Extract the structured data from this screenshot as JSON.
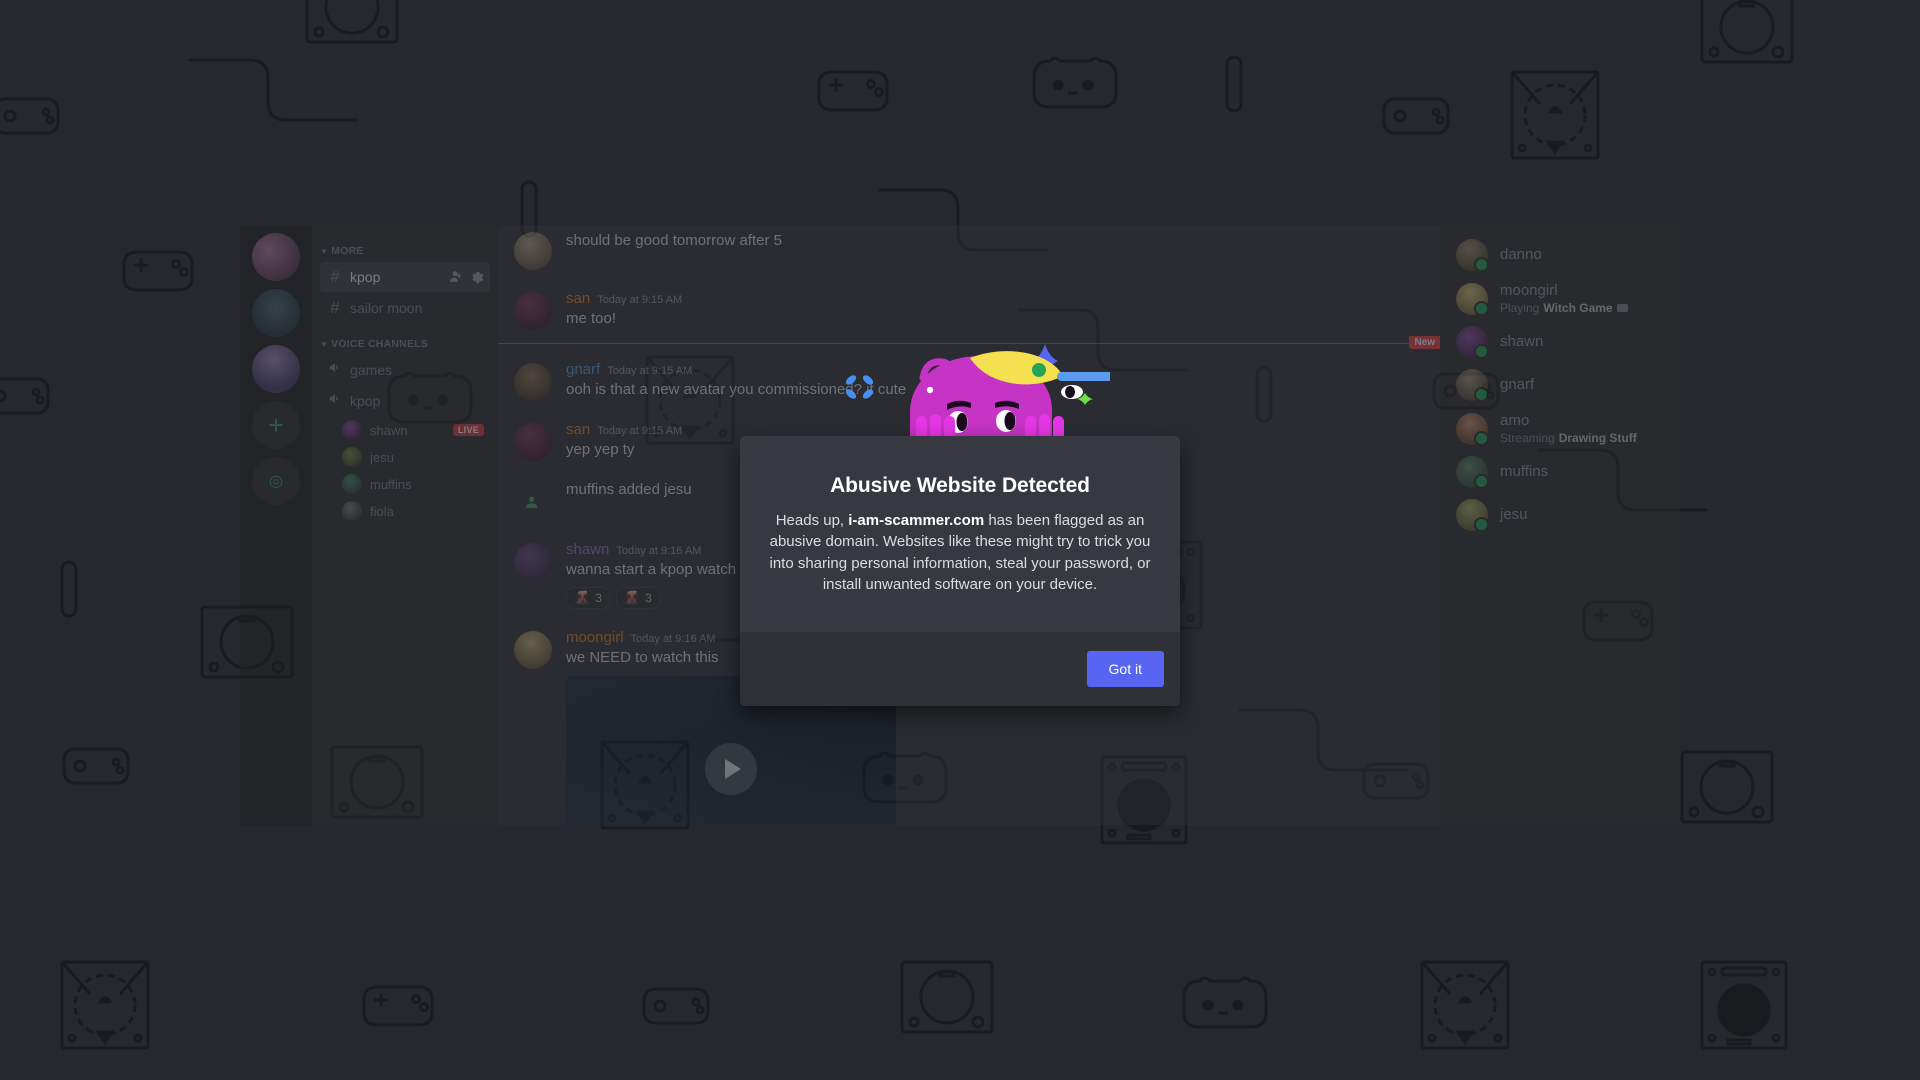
{
  "background": {
    "pattern_name": "gaming-console-pattern",
    "color": "#26282d",
    "line_color": "#1b1d21"
  },
  "app": {
    "guilds": [
      {
        "name": "guild-icon-1"
      },
      {
        "name": "guild-icon-2"
      },
      {
        "name": "guild-icon-3"
      }
    ],
    "add_server_label": "+",
    "explore_label": "◎"
  },
  "sidebar": {
    "categories": [
      {
        "label": "MORE",
        "channels": [
          {
            "name": "kpop",
            "type": "text",
            "active": true,
            "actions": [
              "invite-icon",
              "settings-icon"
            ]
          },
          {
            "name": "sailor moon",
            "type": "text",
            "active": false,
            "actions": []
          }
        ]
      },
      {
        "label": "VOICE CHANNELS",
        "channels": [
          {
            "name": "games",
            "type": "voice",
            "active": false,
            "members": []
          },
          {
            "name": "kpop",
            "type": "voice",
            "active": false,
            "members": [
              {
                "name": "shawn",
                "badge": "LIVE"
              },
              {
                "name": "jesu",
                "badge": ""
              },
              {
                "name": "muffins",
                "badge": ""
              },
              {
                "name": "fiola",
                "badge": ""
              }
            ]
          }
        ]
      }
    ]
  },
  "chat": {
    "messages": [
      {
        "type": "message",
        "compact": true,
        "author": "",
        "color": "c-white",
        "time": "",
        "text": "should be good tomorrow after 5",
        "avatar": "av-a"
      },
      {
        "type": "message",
        "compact": false,
        "author": "san",
        "color": "c-orange",
        "time": "Today at 9:15 AM",
        "text": "me too!",
        "avatar": "av-b"
      },
      {
        "type": "divider",
        "label": "New"
      },
      {
        "type": "message",
        "compact": false,
        "author": "gnarf",
        "color": "c-blue",
        "time": "Today at 9:15 AM",
        "text": "ooh is that a new avatar you commissioned? it cute",
        "avatar": "av-c"
      },
      {
        "type": "message",
        "compact": false,
        "author": "san",
        "color": "c-orange",
        "time": "Today at 9:15 AM",
        "text": "yep yep ty",
        "avatar": "av-b"
      },
      {
        "type": "system",
        "text_prefix": "muffins",
        "text_mid": " added ",
        "text_suffix": "jesu",
        "text": "muffins added jesu"
      },
      {
        "type": "message",
        "compact": false,
        "author": "shawn",
        "color": "c-purple",
        "time": "Today at 9:16 AM",
        "text": "wanna start a kpop watch party?",
        "avatar": "av-d",
        "reactions": [
          {
            "emoji": "🌋",
            "count": "3"
          },
          {
            "emoji": "🌋",
            "count": "3"
          }
        ]
      },
      {
        "type": "message",
        "compact": false,
        "author": "moongirl",
        "color": "c-orange",
        "time": "Today at 9:16 AM",
        "text": "we NEED to watch this",
        "avatar": "av-e",
        "embed": "video-embed"
      }
    ]
  },
  "members": [
    {
      "name": "danno",
      "status": "",
      "status_bold": "",
      "avatar": "mav1",
      "streaming": false
    },
    {
      "name": "moongirl",
      "status": "Playing ",
      "status_bold": "Witch Game",
      "avatar": "mav2",
      "streaming": true
    },
    {
      "name": "shawn",
      "status": "",
      "status_bold": "",
      "avatar": "mav3",
      "streaming": false
    },
    {
      "name": "gnarf",
      "status": "",
      "status_bold": "",
      "avatar": "mav4",
      "streaming": false
    },
    {
      "name": "amo",
      "status": "Streaming ",
      "status_bold": "Drawing Stuff",
      "avatar": "mav5",
      "streaming": false
    },
    {
      "name": "muffins",
      "status": "",
      "status_bold": "",
      "avatar": "mav6",
      "streaming": false
    },
    {
      "name": "jesu",
      "status": "",
      "status_bold": "",
      "avatar": "mav7",
      "streaming": false
    }
  ],
  "modal": {
    "title": "Abusive Website Detected",
    "body_pre": "Heads up, ",
    "body_domain": "i-am-scammer.com",
    "body_post": " has been flagged as an abusive domain. Websites like these might try to trick you into sharing personal information, steal your password, or install unwanted software on your device.",
    "button_label": "Got it",
    "bg_color": "#36393f",
    "footer_color": "#2f3136",
    "button_color": "#5865f2"
  },
  "mascot": {
    "name": "wumpus-peeking-illustration",
    "body_color": "#c634c6",
    "hand_color": "#e636e6",
    "cap_color": "#f5e14f",
    "dot_color": "#23a55a",
    "stripe_color": "#5a9bf0",
    "sparkle_blue": "#4a8ef0",
    "sparkle_green": "#6ee04a",
    "sparkle_indigo": "#5865f2"
  }
}
